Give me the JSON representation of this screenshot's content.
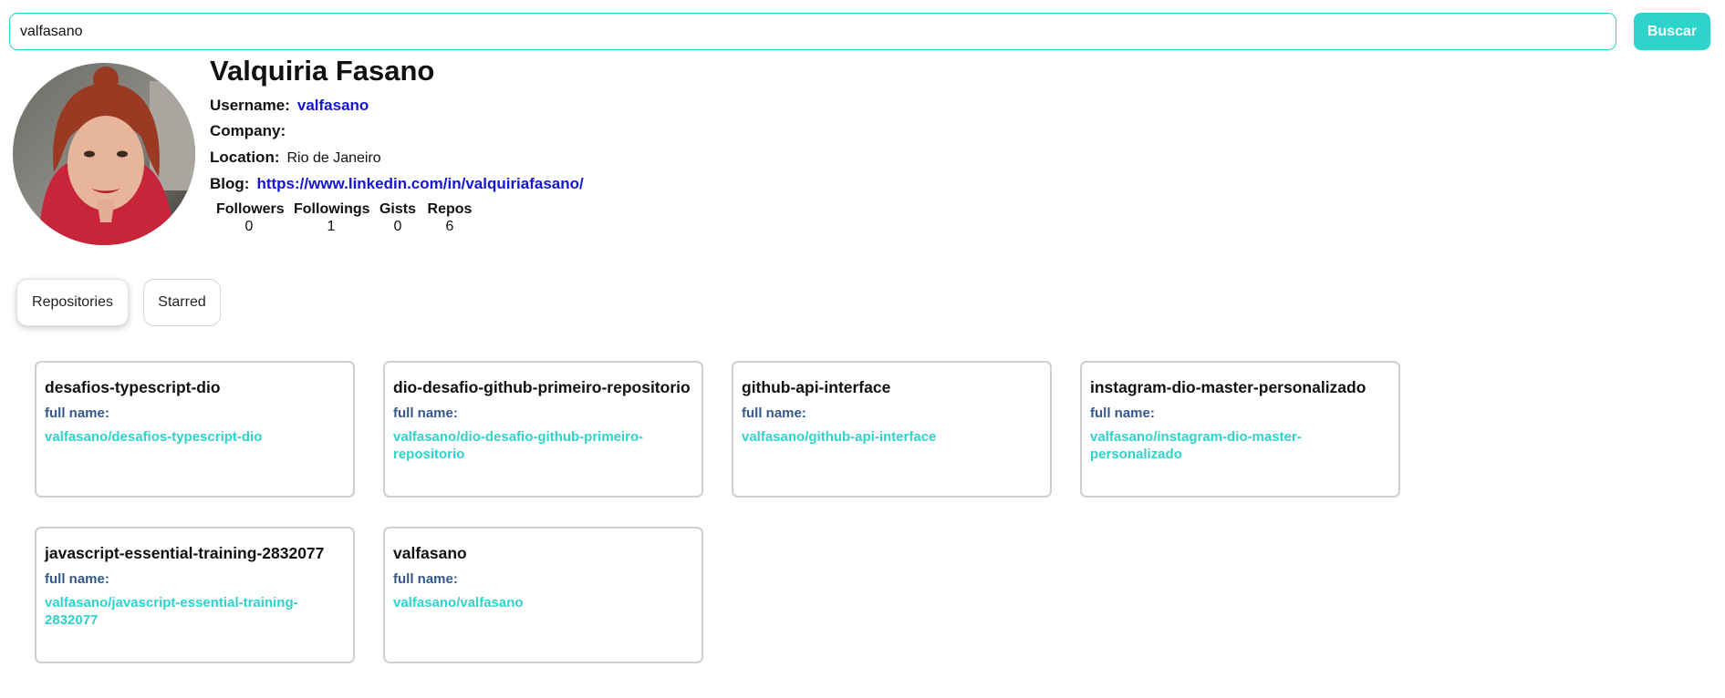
{
  "search": {
    "value": "valfasano",
    "button_label": "Buscar"
  },
  "profile": {
    "name": "Valquiria Fasano",
    "username_label": "Username:",
    "username": "valfasano",
    "company_label": "Company:",
    "company": "",
    "location_label": "Location:",
    "location": "Rio de Janeiro",
    "blog_label": "Blog:",
    "blog": "https://www.linkedin.com/in/valquiriafasano/",
    "stats": [
      {
        "label": "Followers",
        "value": "0"
      },
      {
        "label": "Followings",
        "value": "1"
      },
      {
        "label": "Gists",
        "value": "0"
      },
      {
        "label": "Repos",
        "value": "6"
      }
    ]
  },
  "tabs": [
    {
      "label": "Repositories",
      "active": true
    },
    {
      "label": "Starred",
      "active": false
    }
  ],
  "repos": [
    {
      "title": "desafios-typescript-dio",
      "full_name_label": "full name:",
      "full_name": "valfasano/desafios-typescript-dio"
    },
    {
      "title": "dio-desafio-github-primeiro-repositorio",
      "full_name_label": "full name:",
      "full_name": "valfasano/dio-desafio-github-primeiro-repositorio"
    },
    {
      "title": "github-api-interface",
      "full_name_label": "full name:",
      "full_name": "valfasano/github-api-interface"
    },
    {
      "title": "instagram-dio-master-personalizado",
      "full_name_label": "full name:",
      "full_name": "valfasano/instagram-dio-master-personalizado"
    },
    {
      "title": "javascript-essential-training-2832077",
      "full_name_label": "full name:",
      "full_name": "valfasano/javascript-essential-training-2832077"
    },
    {
      "title": "valfasano",
      "full_name_label": "full name:",
      "full_name": "valfasano/valfasano"
    }
  ],
  "colors": {
    "accent": "#2ed3cc",
    "link": "#1515d6",
    "label_blue": "#35588a"
  }
}
